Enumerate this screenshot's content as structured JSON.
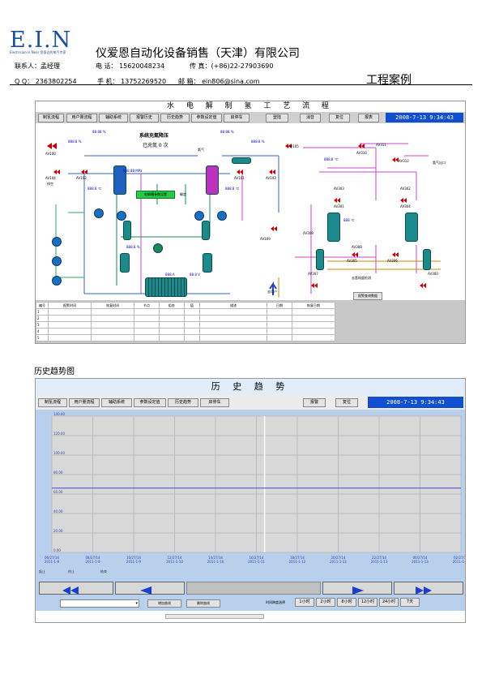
{
  "header": {
    "logo": "E.I.N",
    "logo_sub": "Electrician Is Near 您身边的电气专家",
    "company": "仪爱恩自动化设备销售（天津）有限公司",
    "contact_label": "联系人：",
    "contact": "孟经理",
    "phone_label": "电 话：",
    "phone": "15620048234",
    "fax_label": "传 真：",
    "fax": "(+86)22-27903690",
    "qq_label": "Q Q：",
    "qq": "2363802254",
    "mobile_label": "手 机：",
    "mobile": "13752269520",
    "email_label": "邮 箱：",
    "email": "ein806@sina.com",
    "section_title": "工程案例"
  },
  "screen1": {
    "title": "水 电 解 制 氢 工 艺 流 程",
    "menu": [
      "制氢流程",
      "用户量流程",
      "辅助系统",
      "报警历史",
      "历史趋势",
      "参数设定值",
      "启停车",
      "登陆",
      "消音",
      "复位",
      "报表"
    ],
    "clock": "2008-7-13   9:34:43",
    "status_title": "系统充氮降压",
    "status_line": "已充氮   0  次",
    "green_button": "电解槽参数设置",
    "green_side": "确定",
    "valves": [
      "AV100",
      "AV104",
      "AV102",
      "AV101",
      "AV103",
      "AV105",
      "AV311",
      "AV310",
      "AV312",
      "AV303",
      "AV302",
      "AV301",
      "AV309",
      "AV304",
      "AV305",
      "AV306",
      "AV307",
      "AV308",
      "AV300",
      "AV109"
    ],
    "readings": {
      "r1": "88.88 %",
      "r2": "888.8 %",
      "r3": "888.88 MPa",
      "r4": "888.8 ℃",
      "r5": "888.8 ℃",
      "r6": "888.8 %",
      "r7": "88.88 %",
      "r8": "888.8 %",
      "r9": "888.8 ℃",
      "r10": "888 ℃",
      "r11": "888 A",
      "r12": "88.8 V"
    },
    "misc_labels": [
      "氢气出口",
      "去氢纯度检测",
      "去用户",
      "排空",
      "氧气"
    ],
    "report_button": "报警查询数据",
    "table_headers": [
      "编号",
      "报警时间",
      "恢复时间",
      "节点",
      "组态",
      "值",
      "描述",
      "日期",
      "恢复日期"
    ],
    "table_rows": [
      "1",
      "2",
      "3",
      "4",
      "5"
    ]
  },
  "caption": "历史趋势图",
  "screen2": {
    "title": "历 史 趋 势",
    "menu": [
      "制氢流程",
      "用户量流程",
      "辅助系统",
      "参数设定值",
      "历史趋势",
      "启停车"
    ],
    "right_buttons": [
      "报警",
      "复位"
    ],
    "clock": "2008-7-13   9:34:43",
    "y_ticks": [
      "140.00",
      "120.00",
      "100.00",
      "80.00",
      "60.00",
      "40.00",
      "20.00",
      "0.00"
    ],
    "x_ticks": [
      {
        "date": "06/27/14",
        "time": "2011-1-9"
      },
      {
        "date": "08/27/14",
        "time": "2011-1-9"
      },
      {
        "date": "10/27/14",
        "time": "2011-1-9"
      },
      {
        "date": "12/27/14",
        "time": "2011-1-10"
      },
      {
        "date": "14/27/14",
        "time": "2011-1-10"
      },
      {
        "date": "16/27/14",
        "time": "2011-1-11"
      },
      {
        "date": "18/27/14",
        "time": "2011-1-12"
      },
      {
        "date": "20/27/14",
        "time": "2011-1-12"
      },
      {
        "date": "22/27/14",
        "time": "2011-1-13"
      },
      {
        "date": "00/27/14",
        "time": "2011-1-13"
      },
      {
        "date": "02/27/14",
        "time": "2011-1-14"
      }
    ],
    "bottom_labels": [
      "起止",
      "终止",
      "结束"
    ],
    "add_button": "增加曲线",
    "delete_button": "删除曲线",
    "period_label": "时间跨度选择",
    "periods": [
      "1小时",
      "2小时",
      "8小时",
      "12小时",
      "24小时",
      "7天"
    ],
    "colors": {
      "trend_line": "#4444dd",
      "plot_bg": "#d8d8d8",
      "frame": "#b8d0ec"
    }
  },
  "chart_data": {
    "type": "line",
    "title": "历 史 趋 势",
    "ylim": [
      0,
      140
    ],
    "y_ticks": [
      140,
      120,
      100,
      80,
      60,
      40,
      20,
      0
    ],
    "series": [
      {
        "values": [
          66,
          66,
          66,
          66,
          66,
          66,
          66,
          66,
          66,
          66,
          66
        ]
      }
    ],
    "grid": true
  }
}
